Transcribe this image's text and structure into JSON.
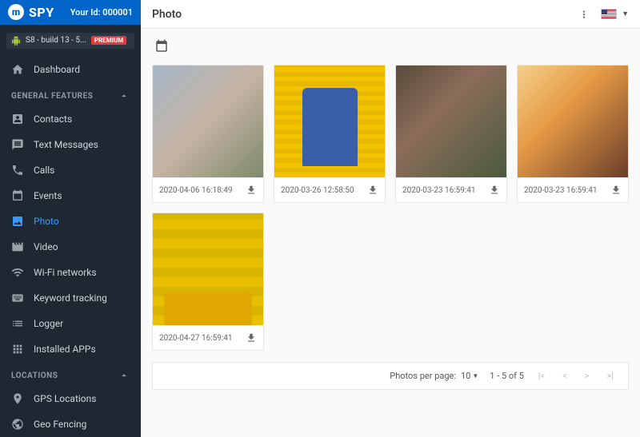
{
  "brand": "SPY",
  "userIdLabel": "Your Id: 000001",
  "device": {
    "name": "S8 - build 13 - 5...",
    "badge": "PREMIUM"
  },
  "nav": {
    "dashboard": "Dashboard",
    "sections": {
      "general": "GENERAL FEATURES",
      "locations": "LOCATIONS"
    },
    "items": {
      "contacts": "Contacts",
      "text_messages": "Text Messages",
      "calls": "Calls",
      "events": "Events",
      "photo": "Photo",
      "video": "Video",
      "wifi": "Wi-Fi networks",
      "keyword": "Keyword tracking",
      "logger": "Logger",
      "apps": "Installed APPs",
      "gps": "GPS Locations",
      "geo": "Geo Fencing"
    }
  },
  "page": {
    "title": "Photo"
  },
  "photos": [
    {
      "ts": "2020-04-06 16:18:49"
    },
    {
      "ts": "2020-03-26 12:58:50"
    },
    {
      "ts": "2020-03-23 16:59:41"
    },
    {
      "ts": "2020-03-23 16:59:41"
    },
    {
      "ts": "2020-04-27 16:59:41"
    }
  ],
  "pager": {
    "label": "Photos per page:",
    "perPage": "10",
    "range": "1 - 5 of 5"
  }
}
